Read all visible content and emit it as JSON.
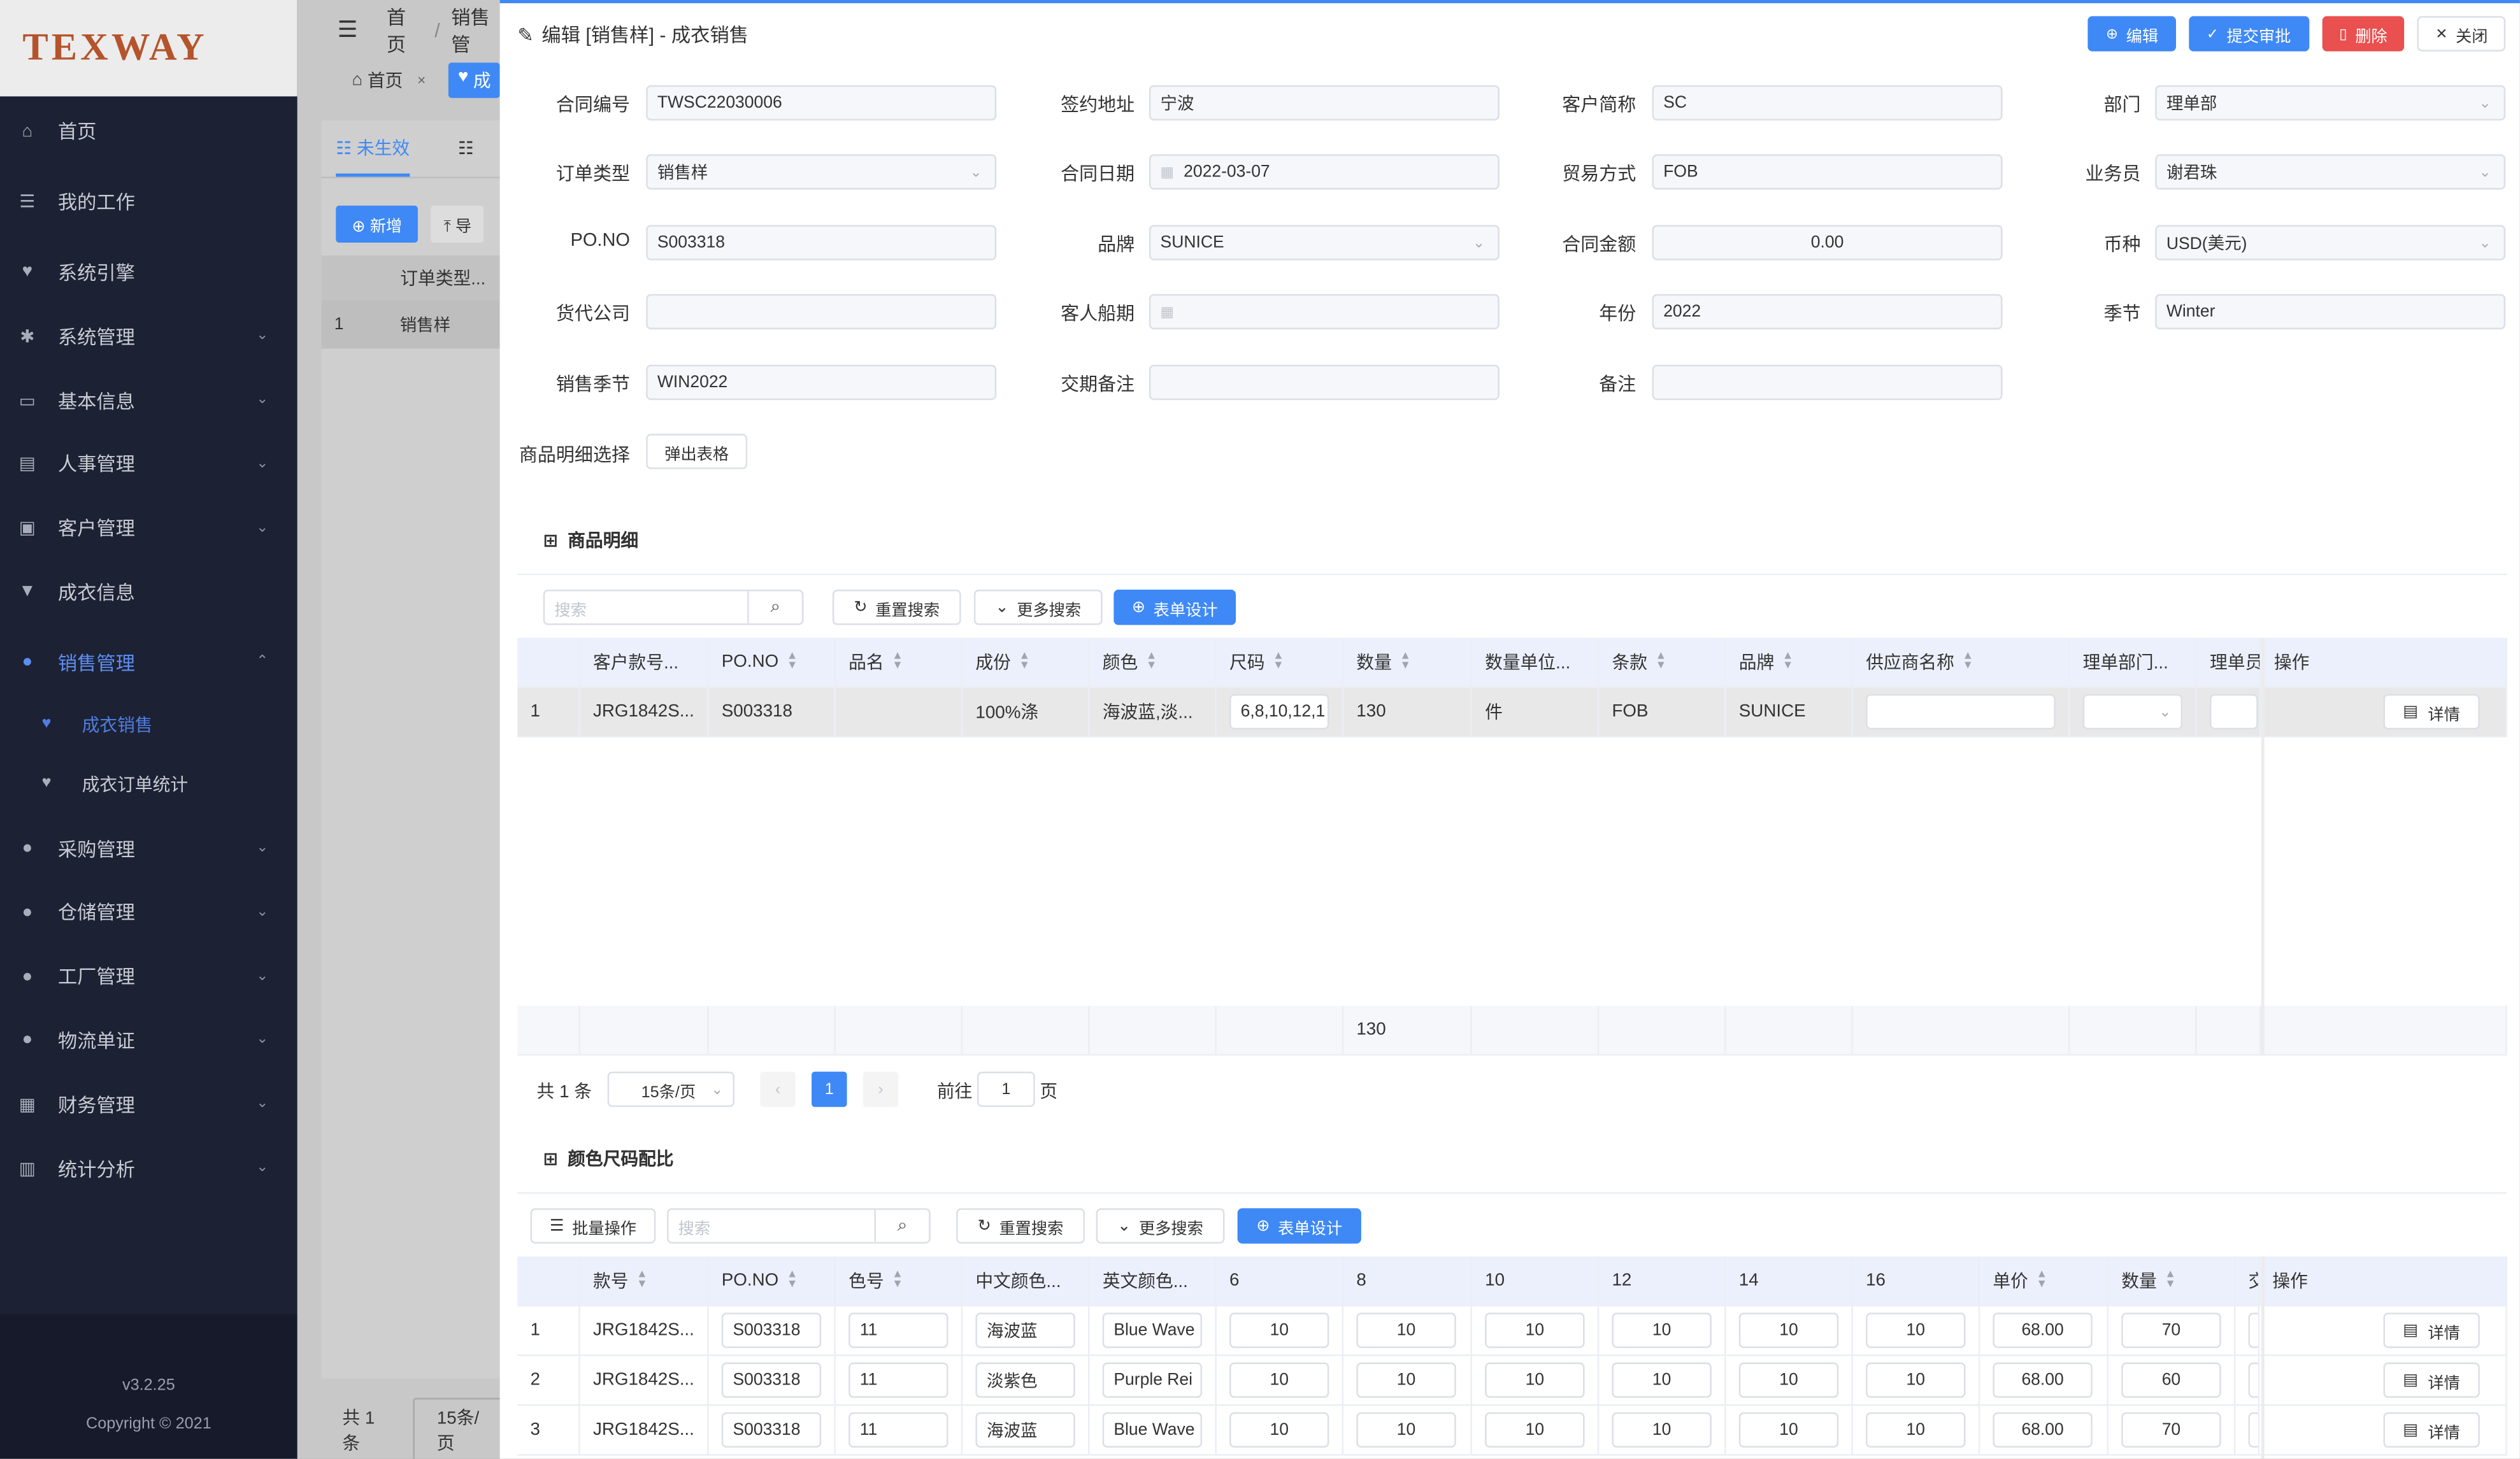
{
  "sidebar": {
    "logo": "TEXWAY",
    "items": [
      {
        "label": "首页",
        "icon": "home-icon"
      },
      {
        "label": "我的工作",
        "icon": "list-icon"
      },
      {
        "label": "系统引擎",
        "icon": "heart-icon"
      },
      {
        "label": "系统管理",
        "icon": "gear-icon"
      },
      {
        "label": "基本信息",
        "icon": "card-icon"
      },
      {
        "label": "人事管理",
        "icon": "id-card-icon"
      },
      {
        "label": "客户管理",
        "icon": "contacts-icon"
      },
      {
        "label": "成衣信息",
        "icon": "shirt-icon"
      },
      {
        "label": "销售管理",
        "icon": "user-icon"
      },
      {
        "label": "成衣销售",
        "icon": "heart-icon"
      },
      {
        "label": "成衣订单统计",
        "icon": "heart-icon"
      },
      {
        "label": "采购管理",
        "icon": "user-icon"
      },
      {
        "label": "仓储管理",
        "icon": "user-icon"
      },
      {
        "label": "工厂管理",
        "icon": "user-icon"
      },
      {
        "label": "物流单证",
        "icon": "user-icon"
      },
      {
        "label": "财务管理",
        "icon": "money-icon"
      },
      {
        "label": "统计分析",
        "icon": "chart-icon"
      }
    ],
    "version": "v3.2.25",
    "copyright": "Copyright © 2021"
  },
  "background": {
    "breadcrumb_home": "首页",
    "breadcrumb_sep": "/",
    "breadcrumb_current": "销售管",
    "tab_home": "首页",
    "tab_close": "×",
    "tab_sales": "成",
    "view_tab": "未生效",
    "add_button": "新增",
    "import_button": "导",
    "col_order_type": "订单类型...",
    "row_index": "1",
    "row_order_type": "销售样",
    "total": "共 1 条",
    "page_size": "15条/页"
  },
  "drawer": {
    "title": "编辑 [销售样] - 成衣销售",
    "buttons": {
      "edit": "编辑",
      "submit": "提交审批",
      "delete": "删除",
      "close": "关闭"
    },
    "form": {
      "contract_no_label": "合同编号",
      "contract_no": "TWSC22030006",
      "sign_place_label": "签约地址",
      "sign_place": "宁波",
      "customer_label": "客户简称",
      "customer": "SC",
      "dept_label": "部门",
      "dept": "理单部",
      "order_type_label": "订单类型",
      "order_type": "销售样",
      "contract_date_label": "合同日期",
      "contract_date": "2022-03-07",
      "trade_label": "贸易方式",
      "trade": "FOB",
      "sales_label": "业务员",
      "sales": "谢君珠",
      "po_label": "PO.NO",
      "po": "S003318",
      "brand_label": "品牌",
      "brand": "SUNICE",
      "amount_label": "合同金额",
      "amount": "0.00",
      "currency_label": "币种",
      "currency": "USD(美元)",
      "forwarder_label": "货代公司",
      "forwarder": "",
      "ship_date_label": "客人船期",
      "ship_date": "",
      "year_label": "年份",
      "year": "2022",
      "season_label": "季节",
      "season": "Winter",
      "sale_season_label": "销售季节",
      "sale_season": "WIN2022",
      "delivery_note_label": "交期备注",
      "delivery_note": "",
      "remark_label": "备注",
      "remark": "",
      "goods_pick_label": "商品明细选择",
      "goods_pick_button": "弹出表格"
    },
    "goods": {
      "title": "商品明细",
      "search_placeholder": "搜索",
      "reset": "重置搜索",
      "more": "更多搜索",
      "design": "表单设计",
      "columns": [
        "客户款号...",
        "PO.NO",
        "品名",
        "成份",
        "颜色",
        "尺码",
        "数量",
        "数量单位...",
        "条款",
        "品牌",
        "供应商名称",
        "理单部门...",
        "理单员",
        "操作"
      ],
      "rows": [
        {
          "idx": "1",
          "style": "JRG1842S...",
          "po": "S003318",
          "name": "",
          "comp": "100%涤",
          "color": "海波蓝,淡...",
          "size": "6,8,10,12,1",
          "qty": "130",
          "unit": "件",
          "term": "FOB",
          "brand": "SUNICE",
          "detail": "详情"
        }
      ],
      "sum_qty": "130",
      "total": "共 1 条",
      "page_size": "15条/页",
      "page": "1",
      "goto_label": "前往",
      "goto_value": "1",
      "page_suffix": "页"
    },
    "color_size": {
      "title": "颜色尺码配比",
      "batch": "批量操作",
      "search_placeholder": "搜索",
      "reset": "重置搜索",
      "more": "更多搜索",
      "design": "表单设计",
      "columns": [
        "款号",
        "PO.NO",
        "色号",
        "中文颜色...",
        "英文颜色...",
        "6",
        "8",
        "10",
        "12",
        "14",
        "16",
        "单价",
        "数量",
        "交",
        "操作"
      ],
      "rows": [
        {
          "idx": "1",
          "style": "JRG1842S...",
          "po": "S003318",
          "code": "11",
          "cn": "海波蓝",
          "en": "Blue Wave",
          "s6": "10",
          "s8": "10",
          "s10": "10",
          "s12": "10",
          "s14": "10",
          "s16": "10",
          "price": "68.00",
          "qty": "70",
          "detail": "详情"
        },
        {
          "idx": "2",
          "style": "JRG1842S...",
          "po": "S003318",
          "code": "11",
          "cn": "淡紫色",
          "en": "Purple Rei",
          "s6": "10",
          "s8": "10",
          "s10": "10",
          "s12": "10",
          "s14": "10",
          "s16": "10",
          "price": "68.00",
          "qty": "60",
          "detail": "详情"
        },
        {
          "idx": "3",
          "style": "JRG1842S...",
          "po": "S003318",
          "code": "11",
          "cn": "海波蓝",
          "en": "Blue Wave",
          "s6": "10",
          "s8": "10",
          "s10": "10",
          "s12": "10",
          "s14": "10",
          "s16": "10",
          "price": "68.00",
          "qty": "70",
          "detail": "详情"
        }
      ]
    }
  },
  "colors": {
    "accent": "#3e89f5",
    "danger": "#e9504f",
    "sidebar": "#1c2133",
    "logo": "#b5542c"
  }
}
